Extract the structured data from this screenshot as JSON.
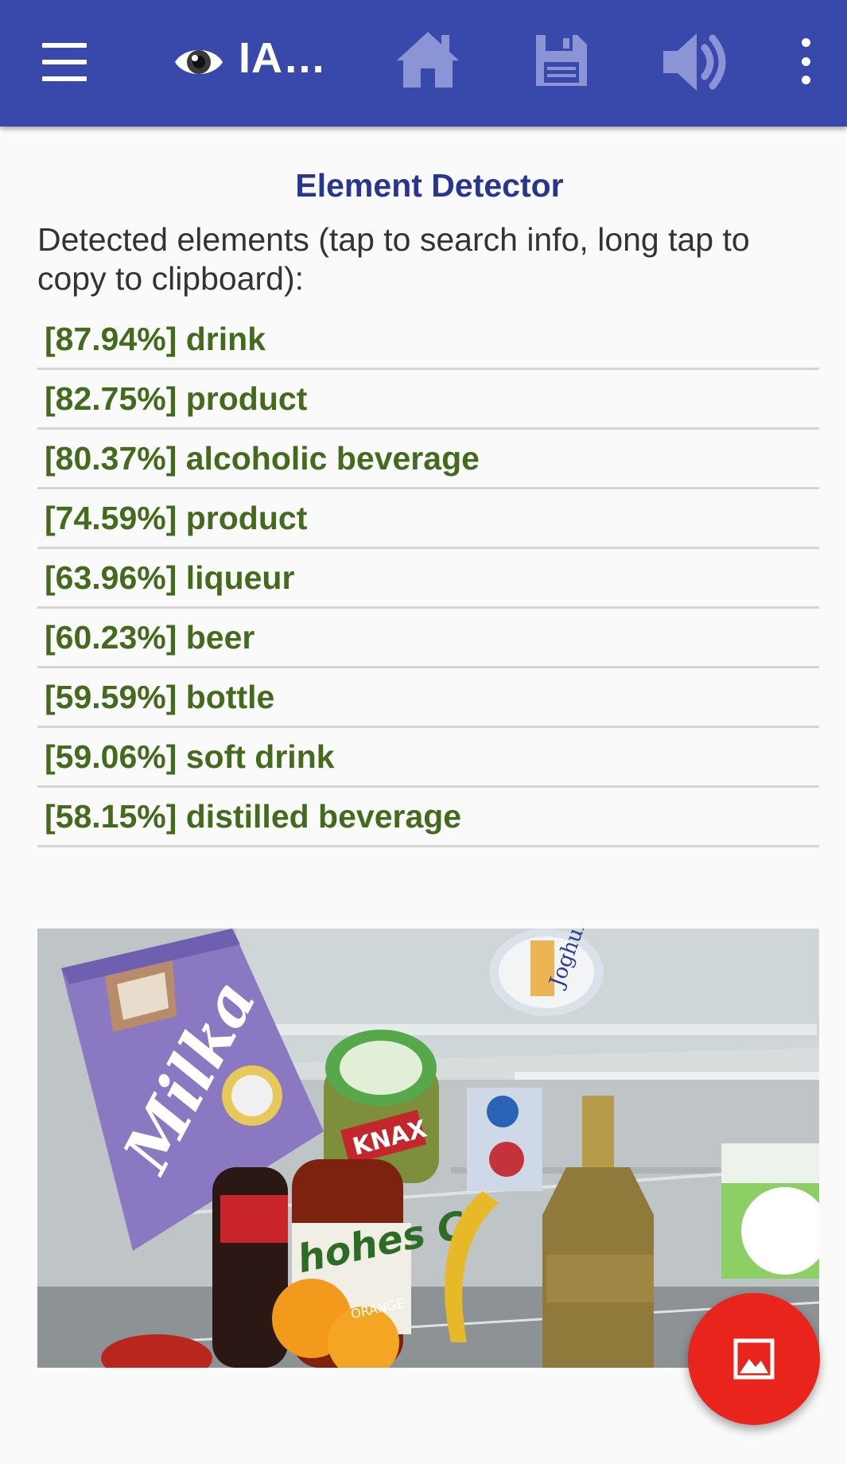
{
  "app_bar": {
    "title": "IA…",
    "background": "#3948ab",
    "icons": [
      "menu-icon",
      "eye-icon",
      "home-icon",
      "save-icon",
      "volume-icon",
      "more-vert-icon"
    ]
  },
  "content": {
    "heading": "Element Detector",
    "instructions": "Detected elements (tap to search info, long tap to copy to clipboard):",
    "results": [
      {
        "label": "[87.94%] drink"
      },
      {
        "label": "[82.75%] product"
      },
      {
        "label": "[80.37%] alcoholic beverage"
      },
      {
        "label": "[74.59%] product"
      },
      {
        "label": "[63.96%] liqueur"
      },
      {
        "label": "[60.23%] beer"
      },
      {
        "label": "[59.59%] bottle"
      },
      {
        "label": "[59.06%] soft drink"
      },
      {
        "label": "[58.15%] distilled beverage"
      }
    ]
  },
  "photo": {
    "packaging_text": {
      "chocolate_brand": "Milka",
      "juice_brand": "hohes C",
      "pickles_brand": "KNAX",
      "juice_flavor": "ORANGE",
      "yogurt_text": "Joghurt"
    }
  },
  "fab": {
    "icon": "image-icon",
    "color": "#e8241c"
  }
}
